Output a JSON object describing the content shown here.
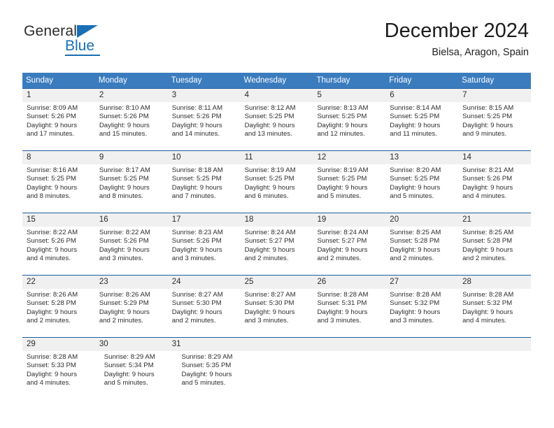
{
  "brand": {
    "name_top": "General",
    "name_bottom": "Blue",
    "accent_color": "#1a6fb5"
  },
  "header": {
    "title": "December 2024",
    "subtitle": "Bielsa, Aragon, Spain"
  },
  "theme": {
    "header_blue": "#3b7cbf",
    "rule_blue": "#1f5fa0",
    "daynum_band": "#f0f0f0"
  },
  "weekdays": [
    "Sunday",
    "Monday",
    "Tuesday",
    "Wednesday",
    "Thursday",
    "Friday",
    "Saturday"
  ],
  "weeks": [
    {
      "days": [
        {
          "num": "1",
          "sunrise": "Sunrise: 8:09 AM",
          "sunset": "Sunset: 5:26 PM",
          "daylight1": "Daylight: 9 hours",
          "daylight2": "and 17 minutes."
        },
        {
          "num": "2",
          "sunrise": "Sunrise: 8:10 AM",
          "sunset": "Sunset: 5:26 PM",
          "daylight1": "Daylight: 9 hours",
          "daylight2": "and 15 minutes."
        },
        {
          "num": "3",
          "sunrise": "Sunrise: 8:11 AM",
          "sunset": "Sunset: 5:26 PM",
          "daylight1": "Daylight: 9 hours",
          "daylight2": "and 14 minutes."
        },
        {
          "num": "4",
          "sunrise": "Sunrise: 8:12 AM",
          "sunset": "Sunset: 5:25 PM",
          "daylight1": "Daylight: 9 hours",
          "daylight2": "and 13 minutes."
        },
        {
          "num": "5",
          "sunrise": "Sunrise: 8:13 AM",
          "sunset": "Sunset: 5:25 PM",
          "daylight1": "Daylight: 9 hours",
          "daylight2": "and 12 minutes."
        },
        {
          "num": "6",
          "sunrise": "Sunrise: 8:14 AM",
          "sunset": "Sunset: 5:25 PM",
          "daylight1": "Daylight: 9 hours",
          "daylight2": "and 11 minutes."
        },
        {
          "num": "7",
          "sunrise": "Sunrise: 8:15 AM",
          "sunset": "Sunset: 5:25 PM",
          "daylight1": "Daylight: 9 hours",
          "daylight2": "and 9 minutes."
        }
      ]
    },
    {
      "days": [
        {
          "num": "8",
          "sunrise": "Sunrise: 8:16 AM",
          "sunset": "Sunset: 5:25 PM",
          "daylight1": "Daylight: 9 hours",
          "daylight2": "and 8 minutes."
        },
        {
          "num": "9",
          "sunrise": "Sunrise: 8:17 AM",
          "sunset": "Sunset: 5:25 PM",
          "daylight1": "Daylight: 9 hours",
          "daylight2": "and 8 minutes."
        },
        {
          "num": "10",
          "sunrise": "Sunrise: 8:18 AM",
          "sunset": "Sunset: 5:25 PM",
          "daylight1": "Daylight: 9 hours",
          "daylight2": "and 7 minutes."
        },
        {
          "num": "11",
          "sunrise": "Sunrise: 8:19 AM",
          "sunset": "Sunset: 5:25 PM",
          "daylight1": "Daylight: 9 hours",
          "daylight2": "and 6 minutes."
        },
        {
          "num": "12",
          "sunrise": "Sunrise: 8:19 AM",
          "sunset": "Sunset: 5:25 PM",
          "daylight1": "Daylight: 9 hours",
          "daylight2": "and 5 minutes."
        },
        {
          "num": "13",
          "sunrise": "Sunrise: 8:20 AM",
          "sunset": "Sunset: 5:25 PM",
          "daylight1": "Daylight: 9 hours",
          "daylight2": "and 5 minutes."
        },
        {
          "num": "14",
          "sunrise": "Sunrise: 8:21 AM",
          "sunset": "Sunset: 5:26 PM",
          "daylight1": "Daylight: 9 hours",
          "daylight2": "and 4 minutes."
        }
      ]
    },
    {
      "days": [
        {
          "num": "15",
          "sunrise": "Sunrise: 8:22 AM",
          "sunset": "Sunset: 5:26 PM",
          "daylight1": "Daylight: 9 hours",
          "daylight2": "and 4 minutes."
        },
        {
          "num": "16",
          "sunrise": "Sunrise: 8:22 AM",
          "sunset": "Sunset: 5:26 PM",
          "daylight1": "Daylight: 9 hours",
          "daylight2": "and 3 minutes."
        },
        {
          "num": "17",
          "sunrise": "Sunrise: 8:23 AM",
          "sunset": "Sunset: 5:26 PM",
          "daylight1": "Daylight: 9 hours",
          "daylight2": "and 3 minutes."
        },
        {
          "num": "18",
          "sunrise": "Sunrise: 8:24 AM",
          "sunset": "Sunset: 5:27 PM",
          "daylight1": "Daylight: 9 hours",
          "daylight2": "and 2 minutes."
        },
        {
          "num": "19",
          "sunrise": "Sunrise: 8:24 AM",
          "sunset": "Sunset: 5:27 PM",
          "daylight1": "Daylight: 9 hours",
          "daylight2": "and 2 minutes."
        },
        {
          "num": "20",
          "sunrise": "Sunrise: 8:25 AM",
          "sunset": "Sunset: 5:28 PM",
          "daylight1": "Daylight: 9 hours",
          "daylight2": "and 2 minutes."
        },
        {
          "num": "21",
          "sunrise": "Sunrise: 8:25 AM",
          "sunset": "Sunset: 5:28 PM",
          "daylight1": "Daylight: 9 hours",
          "daylight2": "and 2 minutes."
        }
      ]
    },
    {
      "days": [
        {
          "num": "22",
          "sunrise": "Sunrise: 8:26 AM",
          "sunset": "Sunset: 5:28 PM",
          "daylight1": "Daylight: 9 hours",
          "daylight2": "and 2 minutes."
        },
        {
          "num": "23",
          "sunrise": "Sunrise: 8:26 AM",
          "sunset": "Sunset: 5:29 PM",
          "daylight1": "Daylight: 9 hours",
          "daylight2": "and 2 minutes."
        },
        {
          "num": "24",
          "sunrise": "Sunrise: 8:27 AM",
          "sunset": "Sunset: 5:30 PM",
          "daylight1": "Daylight: 9 hours",
          "daylight2": "and 2 minutes."
        },
        {
          "num": "25",
          "sunrise": "Sunrise: 8:27 AM",
          "sunset": "Sunset: 5:30 PM",
          "daylight1": "Daylight: 9 hours",
          "daylight2": "and 3 minutes."
        },
        {
          "num": "26",
          "sunrise": "Sunrise: 8:28 AM",
          "sunset": "Sunset: 5:31 PM",
          "daylight1": "Daylight: 9 hours",
          "daylight2": "and 3 minutes."
        },
        {
          "num": "27",
          "sunrise": "Sunrise: 8:28 AM",
          "sunset": "Sunset: 5:32 PM",
          "daylight1": "Daylight: 9 hours",
          "daylight2": "and 3 minutes."
        },
        {
          "num": "28",
          "sunrise": "Sunrise: 8:28 AM",
          "sunset": "Sunset: 5:32 PM",
          "daylight1": "Daylight: 9 hours",
          "daylight2": "and 4 minutes."
        }
      ]
    },
    {
      "days": [
        {
          "num": "29",
          "sunrise": "Sunrise: 8:28 AM",
          "sunset": "Sunset: 5:33 PM",
          "daylight1": "Daylight: 9 hours",
          "daylight2": "and 4 minutes."
        },
        {
          "num": "30",
          "sunrise": "Sunrise: 8:29 AM",
          "sunset": "Sunset: 5:34 PM",
          "daylight1": "Daylight: 9 hours",
          "daylight2": "and 5 minutes."
        },
        {
          "num": "31",
          "sunrise": "Sunrise: 8:29 AM",
          "sunset": "Sunset: 5:35 PM",
          "daylight1": "Daylight: 9 hours",
          "daylight2": "and 5 minutes."
        },
        {
          "num": "",
          "sunrise": "",
          "sunset": "",
          "daylight1": "",
          "daylight2": ""
        },
        {
          "num": "",
          "sunrise": "",
          "sunset": "",
          "daylight1": "",
          "daylight2": ""
        },
        {
          "num": "",
          "sunrise": "",
          "sunset": "",
          "daylight1": "",
          "daylight2": ""
        },
        {
          "num": "",
          "sunrise": "",
          "sunset": "",
          "daylight1": "",
          "daylight2": ""
        }
      ]
    }
  ]
}
